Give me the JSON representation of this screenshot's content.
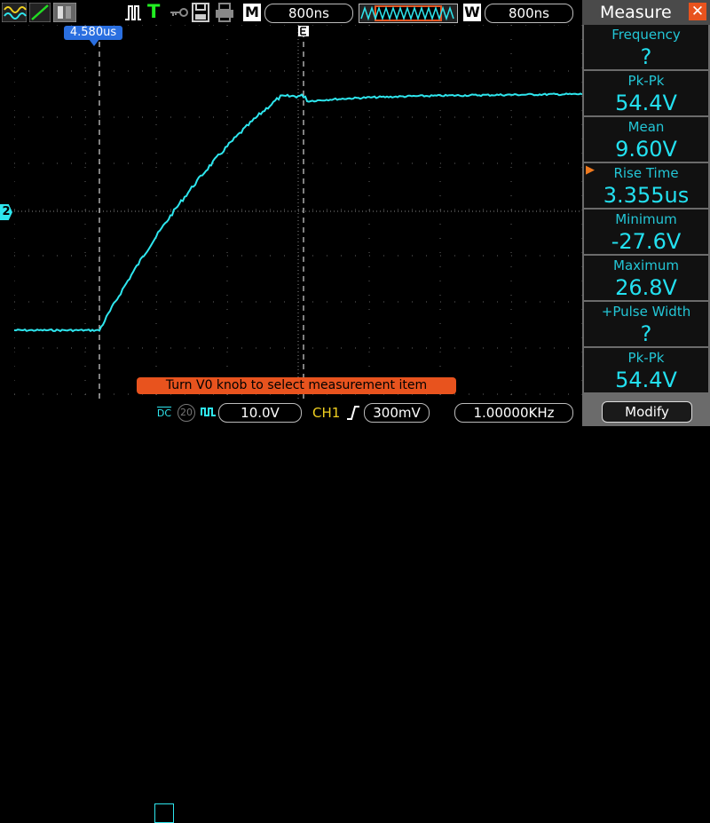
{
  "top_bar": {
    "timebase_label": "M",
    "timebase_value": "800ns",
    "window_label": "W",
    "window_value": "800ns",
    "trigger_label": "T"
  },
  "cursor": {
    "label": "4.580us"
  },
  "channel_marker": "2",
  "hint_text": "Turn V0 knob to select measurement item",
  "bottom_bar": {
    "coupling": "DC",
    "bandwidth_badge": "20",
    "ch_scale": "10.0V",
    "trigger_channel": "CH1",
    "trigger_level": "300mV",
    "frequency": "1.00000KHz"
  },
  "measure_panel": {
    "title": "Measure",
    "items": [
      {
        "name": "Frequency",
        "value": "?"
      },
      {
        "name": "Pk-Pk",
        "value": "54.4V"
      },
      {
        "name": "Mean",
        "value": "9.60V"
      },
      {
        "name": "Rise Time",
        "value": "3.355us",
        "selected": true
      },
      {
        "name": "Minimum",
        "value": "-27.6V"
      },
      {
        "name": "Maximum",
        "value": "26.8V"
      },
      {
        "name": "+Pulse Width",
        "value": "?"
      },
      {
        "name": "Pk-Pk",
        "value": "54.4V"
      }
    ],
    "modify_label": "Modify"
  },
  "colors": {
    "trace": "#2ee6ee",
    "accent": "#e8531e",
    "panel_bg": "#6b6b6b"
  }
}
